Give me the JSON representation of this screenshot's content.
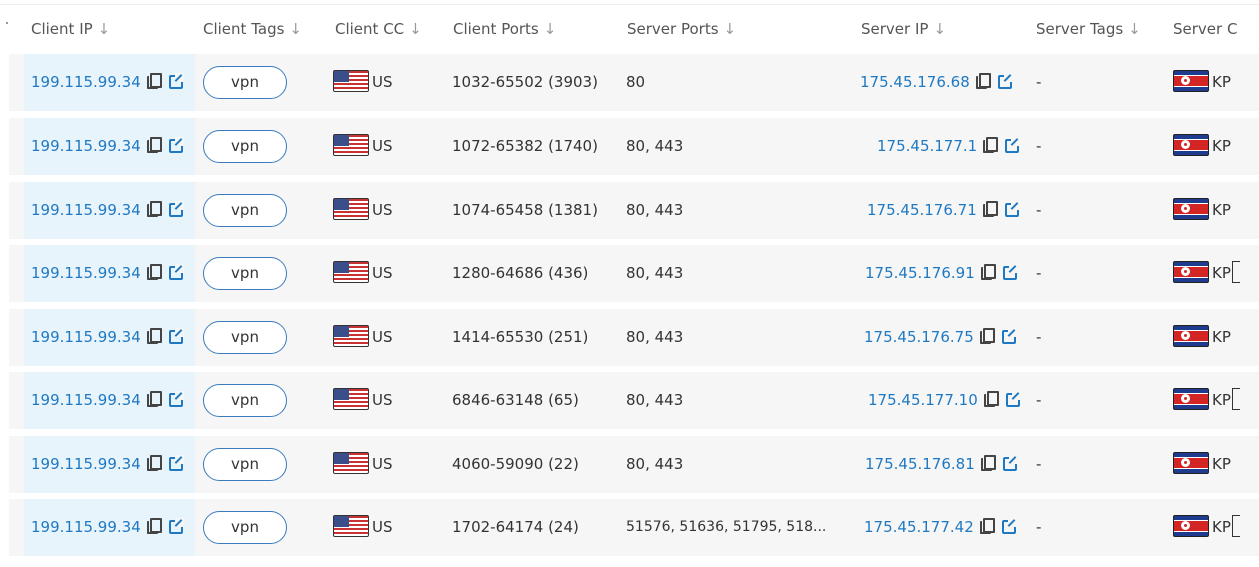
{
  "header": {
    "columns": [
      {
        "label": "Client IP"
      },
      {
        "label": "Client Tags"
      },
      {
        "label": "Client CC"
      },
      {
        "label": "Client Ports"
      },
      {
        "label": "Server Ports"
      },
      {
        "label": "Server IP"
      },
      {
        "label": "Server Tags"
      },
      {
        "label": "Server C"
      }
    ],
    "sort_arrow": "↓"
  },
  "rows": [
    {
      "client_ip": "199.115.99.34",
      "client_tag": "vpn",
      "client_cc": "US",
      "client_ports": "1032-65502 (3903)",
      "server_ports": "80",
      "server_ip": "175.45.176.68",
      "server_tags": "-",
      "server_cc": "KP"
    },
    {
      "client_ip": "199.115.99.34",
      "client_tag": "vpn",
      "client_cc": "US",
      "client_ports": "1072-65382 (1740)",
      "server_ports": "80, 443",
      "server_ip": "175.45.177.1",
      "server_tags": "-",
      "server_cc": "KP"
    },
    {
      "client_ip": "199.115.99.34",
      "client_tag": "vpn",
      "client_cc": "US",
      "client_ports": "1074-65458 (1381)",
      "server_ports": "80, 443",
      "server_ip": "175.45.176.71",
      "server_tags": "-",
      "server_cc": "KP"
    },
    {
      "client_ip": "199.115.99.34",
      "client_tag": "vpn",
      "client_cc": "US",
      "client_ports": "1280-64686 (436)",
      "server_ports": "80, 443",
      "server_ip": "175.45.176.91",
      "server_tags": "-",
      "server_cc": "KP"
    },
    {
      "client_ip": "199.115.99.34",
      "client_tag": "vpn",
      "client_cc": "US",
      "client_ports": "1414-65530 (251)",
      "server_ports": "80, 443",
      "server_ip": "175.45.176.75",
      "server_tags": "-",
      "server_cc": "KP"
    },
    {
      "client_ip": "199.115.99.34",
      "client_tag": "vpn",
      "client_cc": "US",
      "client_ports": "6846-63148 (65)",
      "server_ports": "80, 443",
      "server_ip": "175.45.177.10",
      "server_tags": "-",
      "server_cc": "KP"
    },
    {
      "client_ip": "199.115.99.34",
      "client_tag": "vpn",
      "client_cc": "US",
      "client_ports": "4060-59090 (22)",
      "server_ports": "80, 443",
      "server_ip": "175.45.176.81",
      "server_tags": "-",
      "server_cc": "KP"
    },
    {
      "client_ip": "199.115.99.34",
      "client_tag": "vpn",
      "client_cc": "US",
      "client_ports": "1702-64174 (24)",
      "server_ports": "51576, 51636, 51795, 518...",
      "server_ip": "175.45.177.42",
      "server_tags": "-",
      "server_cc": "KP"
    }
  ],
  "colors": {
    "link": "#1f79c2",
    "client_ip_highlight": "#e8f4fc",
    "row_background": "#f6f6f6",
    "tag_border": "#3a7cc0"
  },
  "icons": [
    "copy-icon",
    "external-link-icon",
    "us-flag-icon",
    "kp-flag-icon",
    "sort-arrow-icon"
  ]
}
